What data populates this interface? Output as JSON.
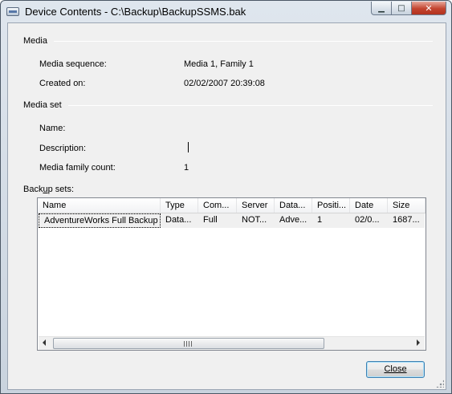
{
  "window": {
    "title": "Device Contents - C:\\Backup\\BackupSSMS.bak",
    "minimize_glyph": "▁",
    "maximize_glyph": "□",
    "close_glyph": "✕"
  },
  "media": {
    "header": "Media",
    "sequence_label": "Media sequence:",
    "sequence_value": "Media 1, Family 1",
    "created_label": "Created on:",
    "created_value": "02/02/2007 20:39:08"
  },
  "media_set": {
    "header": "Media set",
    "name_label": "Name:",
    "name_value": "",
    "description_label": "Description:",
    "description_value": "",
    "family_count_label": "Media family count:",
    "family_count_value": "1"
  },
  "backup_sets": {
    "label_pre": "Back",
    "label_accel": "u",
    "label_post": "p sets:",
    "columns": [
      "Name",
      "Type",
      "Com...",
      "Server",
      "Data...",
      "Positi...",
      "Date",
      "Size"
    ],
    "rows": [
      [
        "AdventureWorks Full Backup",
        "Data...",
        "Full",
        "NOT...",
        "Adve...",
        "1",
        "02/0...",
        "1687..."
      ]
    ],
    "scroll_grip": "III"
  },
  "buttons": {
    "close_label": "Close"
  }
}
